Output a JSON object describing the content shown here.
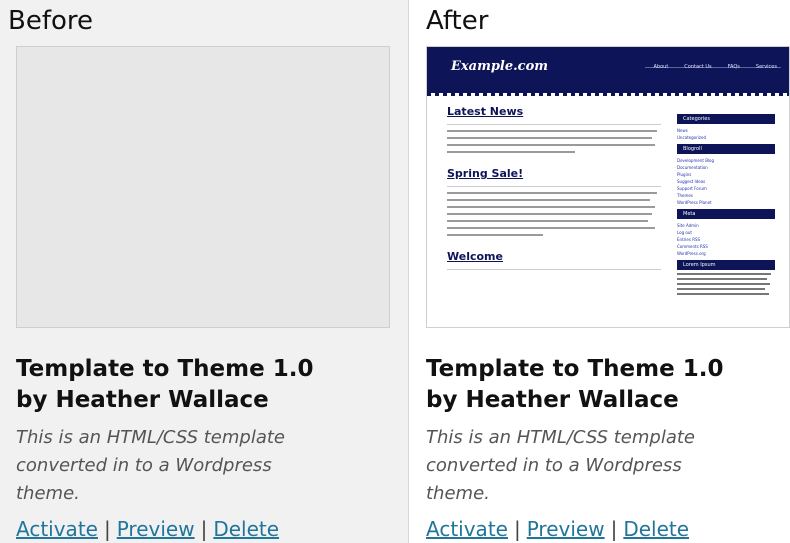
{
  "before": {
    "label": "Before",
    "theme_title_line1": "Template to Theme 1.0",
    "theme_title_line2": "by Heather Wallace",
    "description_line1": "This is an HTML/CSS template",
    "description_line2": "converted in to a Wordpress",
    "description_line3": "theme.",
    "actions": {
      "activate": "Activate",
      "preview": "Preview",
      "delete": "Delete",
      "separator": "|"
    }
  },
  "after": {
    "label": "After",
    "theme_title_line1": "Template to Theme 1.0",
    "theme_title_line2": "by Heather Wallace",
    "description_line1": "This is an HTML/CSS template",
    "description_line2": "converted in to a Wordpress",
    "description_line3": "theme.",
    "actions": {
      "activate": "Activate",
      "preview": "Preview",
      "delete": "Delete",
      "separator": "|"
    },
    "thumbnail": {
      "site_title": "Example.com",
      "nav": [
        "About",
        "Contact Us",
        "FAQs",
        "Services"
      ],
      "posts": [
        "Latest News",
        "Spring Sale!",
        "Welcome"
      ],
      "sidebar_headings": [
        "Categories",
        "Blogroll",
        "Meta",
        "Lorem Ipsum"
      ],
      "sidebar_links": [
        "News",
        "Uncategorized",
        "Development Blog",
        "Documentation",
        "Plugins",
        "Suggest Ideas",
        "Support Forum",
        "Themes",
        "WordPress Planet",
        "Site Admin",
        "Log out",
        "Entries RSS",
        "Comments RSS",
        "WordPress.org"
      ]
    }
  },
  "colors": {
    "link": "#21759b",
    "header_navy": "#0d1458"
  }
}
